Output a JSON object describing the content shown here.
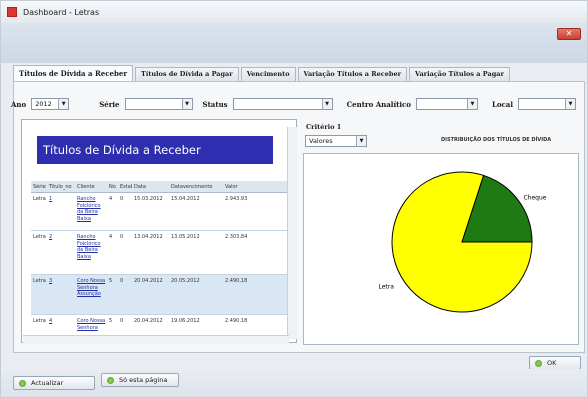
{
  "window": {
    "title": "Dashboard - Letras"
  },
  "tabs": [
    {
      "label": "Títulos de Dívida a Receber",
      "active": true
    },
    {
      "label": "Títulos de Dívida a Pagar"
    },
    {
      "label": "Vencimento"
    },
    {
      "label": "Variação Títulos a Receber"
    },
    {
      "label": "Variação Títulos a Pagar"
    }
  ],
  "filters": {
    "ano_label": "Ano",
    "ano_value": "2012",
    "serie_label": "Série",
    "status_label": "Status",
    "centro_label": "Centro Analítico",
    "local_label": "Local"
  },
  "report": {
    "title": "Títulos de Dívida a Receber",
    "columns": [
      "Série",
      "Titulo_no",
      "Cliente",
      "No",
      "Estab",
      "Data",
      "Datavencimento",
      "Valor"
    ],
    "rows": [
      {
        "serie": "Letra",
        "titulo": "1",
        "cliente": "Rancho Folclórico da Beira Baixa",
        "no": "4",
        "estab": "0",
        "data": "15.03.2012",
        "venc": "15.04.2012",
        "valor": "2.943,93"
      },
      {
        "serie": "Letra",
        "titulo": "2",
        "cliente": "Rancho Folclórico da Beira Baixa",
        "no": "4",
        "estab": "0",
        "data": "13.04.2012",
        "venc": "13.05.2012",
        "valor": "2.303,84"
      },
      {
        "serie": "Letra",
        "titulo": "3",
        "cliente": "Coro Nossa Senhora Assunção",
        "no": "5",
        "estab": "0",
        "data": "20.04.2012",
        "venc": "20.05.2012",
        "valor": "2.490,18"
      },
      {
        "serie": "Letra",
        "titulo": "4",
        "cliente": "Coro Nossa Senhora",
        "no": "5",
        "estab": "0",
        "data": "20.04.2012",
        "venc": "19.06.2012",
        "valor": "2.490,18"
      }
    ]
  },
  "criteria": {
    "label": "Critério 1",
    "value": "Valores"
  },
  "chart_data": {
    "type": "pie",
    "title": "DISTRIBUIÇÃO DOS TÍTULOS DE DÍVIDA",
    "slices": [
      {
        "name": "Letra",
        "value": 80,
        "color": "#ffff00"
      },
      {
        "name": "Cheque",
        "value": 20,
        "color": "#1f7a14"
      }
    ]
  },
  "buttons": {
    "ok": "OK",
    "atualizar": "Actualizar",
    "so_esta_pagina": "Só esta página"
  }
}
